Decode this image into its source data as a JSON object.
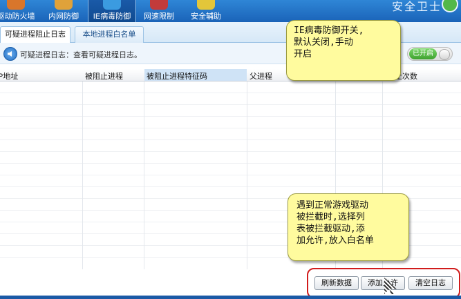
{
  "toolbar": {
    "items": [
      {
        "label": "驱动防火墙",
        "icon": "firewall-icon",
        "color": "#d9762b"
      },
      {
        "label": "内网防御",
        "icon": "lan-defense-icon",
        "color": "#e0a23a"
      },
      {
        "label": "IE病毒防御",
        "icon": "ie-shield-icon",
        "color": "#3b9be0",
        "active": true
      },
      {
        "label": "网速限制",
        "icon": "speed-limit-icon",
        "color": "#c23b3b"
      },
      {
        "label": "安全辅助",
        "icon": "security-assist-icon",
        "color": "#e3c63a"
      }
    ],
    "brand": "安全卫士"
  },
  "tabs": [
    {
      "label": "可疑进程阻止日志",
      "active": true
    },
    {
      "label": "本地进程白名单",
      "active": false
    }
  ],
  "info": {
    "icon": "speaker-icon",
    "text": "可疑进程日志：查看可疑进程日志。",
    "toggle_label": "已开启",
    "toggle_on": true
  },
  "table": {
    "columns": [
      "IP地址",
      "被阻止进程",
      "被阻止进程特征码",
      "父进程",
      "",
      "阻止次数"
    ]
  },
  "callouts": {
    "top": [
      "IE病毒防御开关,",
      "默认关闭,手动",
      "开启"
    ],
    "bottom": [
      "遇到正常游戏驱动",
      "被拦截时,选择列",
      "表被拦截驱动,添",
      "加允许,放入白名单"
    ]
  },
  "buttons": {
    "refresh": "刷新数据",
    "add": "添加允许",
    "clear": "清空日志"
  },
  "colors": {
    "toolbar": "#1a63b8",
    "callout_bg": "#fffb9e",
    "highlight_border": "#d11c1c",
    "toggle_on": "#3ea12e"
  }
}
